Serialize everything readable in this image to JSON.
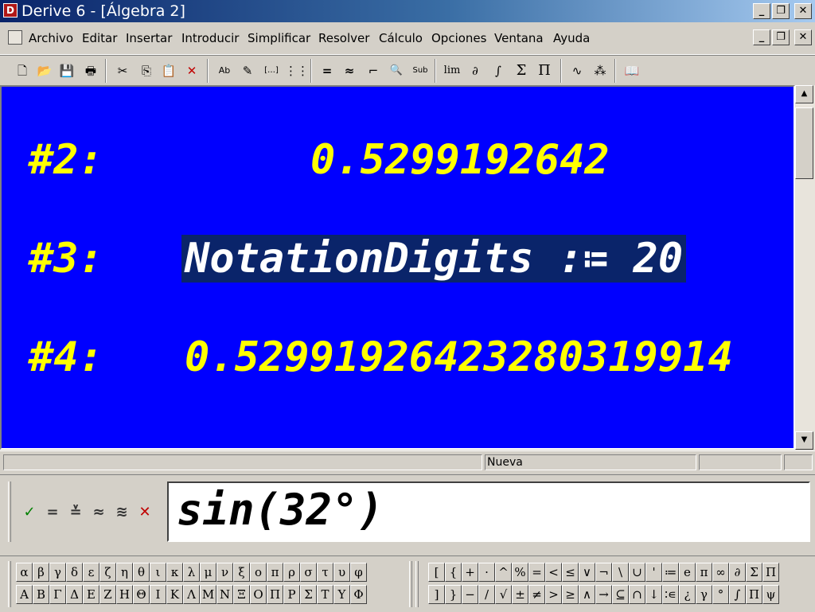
{
  "window": {
    "title": "Derive 6 - [Álgebra 2]",
    "app_icon_glyph": "D",
    "controls": [
      "_",
      "❐",
      "✕"
    ],
    "doc_controls": [
      "_",
      "❐",
      "✕"
    ]
  },
  "menu": {
    "items": [
      "Archivo",
      "Editar",
      "Insertar",
      "Introducir",
      "Simplificar",
      "Resolver",
      "Cálculo",
      "Opciones",
      "Ventana",
      "Ayuda"
    ]
  },
  "toolbar": {
    "buttons": [
      {
        "name": "new-icon",
        "glyph": "🗋"
      },
      {
        "name": "open-icon",
        "glyph": "📂"
      },
      {
        "name": "save-icon",
        "glyph": "💾"
      },
      {
        "name": "print-icon",
        "glyph": "🖶"
      },
      {
        "name": "cut-icon",
        "glyph": "✂"
      },
      {
        "name": "copy-icon",
        "glyph": "⎘"
      },
      {
        "name": "paste-icon",
        "glyph": "📋"
      },
      {
        "name": "delete-icon",
        "glyph": "✕"
      },
      {
        "name": "insert-text-icon",
        "glyph": "Ab"
      },
      {
        "name": "insert-note-icon",
        "glyph": "✎"
      },
      {
        "name": "insert-vector-icon",
        "glyph": "[…]"
      },
      {
        "name": "insert-matrix-icon",
        "glyph": "⋮⋮"
      },
      {
        "name": "simplify-icon",
        "glyph": "="
      },
      {
        "name": "approximate-icon",
        "glyph": "≈"
      },
      {
        "name": "step-icon",
        "glyph": "⌐"
      },
      {
        "name": "zoom-icon",
        "glyph": "🔍"
      },
      {
        "name": "substitute-icon",
        "glyph": "Sub"
      },
      {
        "name": "limit-icon",
        "glyph": "lim"
      },
      {
        "name": "derivative-icon",
        "glyph": "∂"
      },
      {
        "name": "integral-icon",
        "glyph": "∫"
      },
      {
        "name": "sum-icon",
        "glyph": "Σ"
      },
      {
        "name": "product-icon",
        "glyph": "Π"
      },
      {
        "name": "plot-2d-icon",
        "glyph": "∿"
      },
      {
        "name": "plot-3d-icon",
        "glyph": "⁂"
      },
      {
        "name": "help-book-icon",
        "glyph": "📖"
      }
    ]
  },
  "algebra": {
    "lines": [
      {
        "label": "#2:",
        "expr": "0.5299192642"
      },
      {
        "label": "#3:",
        "expr": "NotationDigits :≔ 20",
        "selected": true
      },
      {
        "label": "#4:",
        "expr": "0.52991926423280319914"
      }
    ],
    "bg_color": "#0000ff",
    "text_color": "#ffff00"
  },
  "status": {
    "panel_text": "Nueva"
  },
  "entry": {
    "value": "sin(32°)",
    "buttons": [
      {
        "name": "accept-icon",
        "glyph": "✓"
      },
      {
        "name": "enter-simplify-icon",
        "glyph": "="
      },
      {
        "name": "enter-simplify-keep-icon",
        "glyph": "≚"
      },
      {
        "name": "enter-approximate-icon",
        "glyph": "≈"
      },
      {
        "name": "enter-approximate-keep-icon",
        "glyph": "≋"
      },
      {
        "name": "cancel-icon",
        "glyph": "✕"
      }
    ]
  },
  "palette": {
    "greek_lower": [
      "α",
      "β",
      "γ",
      "δ",
      "ε",
      "ζ",
      "η",
      "θ",
      "ι",
      "κ",
      "λ",
      "μ",
      "ν",
      "ξ",
      "ο",
      "π",
      "ρ",
      "σ",
      "τ",
      "υ",
      "φ"
    ],
    "greek_upper": [
      "Α",
      "Β",
      "Γ",
      "Δ",
      "Ε",
      "Ζ",
      "Η",
      "Θ",
      "Ι",
      "Κ",
      "Λ",
      "Μ",
      "Ν",
      "Ξ",
      "Ο",
      "Π",
      "Ρ",
      "Σ",
      "Τ",
      "Υ",
      "Φ"
    ],
    "math_row1": [
      "[",
      "{",
      "+",
      "·",
      "^",
      "%",
      "=",
      "<",
      "≤",
      "∨",
      "¬",
      "\\",
      "∪",
      "'",
      "≔",
      "e",
      "π",
      "∞",
      "∂",
      "Σ",
      "Π"
    ],
    "math_row2": [
      "]",
      "}",
      "−",
      "/",
      "√",
      "±",
      "≠",
      ">",
      "≥",
      "∧",
      "→",
      "⊆",
      "∩",
      "↓",
      "∶∊",
      "¿",
      "γ",
      "°",
      "∫",
      "Π",
      "ψ"
    ]
  }
}
